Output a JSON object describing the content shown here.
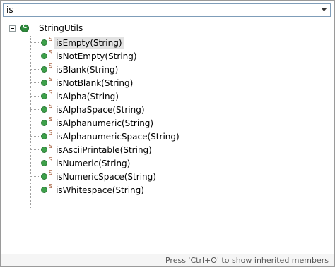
{
  "filter": {
    "value": "is"
  },
  "tree": {
    "root_label": "StringUtils",
    "items": [
      "isEmpty(String)",
      "isNotEmpty(String)",
      "isBlank(String)",
      "isNotBlank(String)",
      "isAlpha(String)",
      "isAlphaSpace(String)",
      "isAlphanumeric(String)",
      "isAlphanumericSpace(String)",
      "isAsciiPrintable(String)",
      "isNumeric(String)",
      "isNumericSpace(String)",
      "isWhitespace(String)"
    ],
    "static_marker": "S",
    "class_icon_letter": "C"
  },
  "status": {
    "text": "Press 'Ctrl+O' to show inherited members"
  },
  "colors": {
    "method_icon": "#3ea04a",
    "class_icon": "#2e8b3c",
    "selection": "#e3e3e3"
  }
}
